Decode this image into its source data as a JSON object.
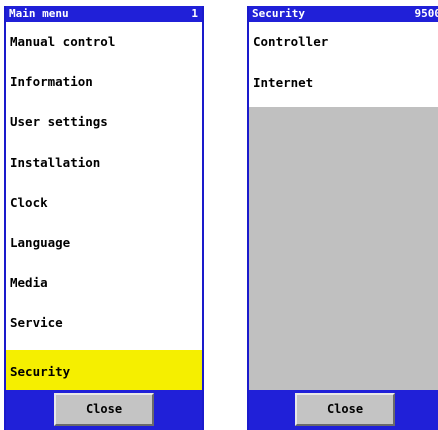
{
  "main_menu": {
    "title": "Main menu",
    "code": "1",
    "items": [
      {
        "label": "Manual control"
      },
      {
        "label": "Information"
      },
      {
        "label": "User settings"
      },
      {
        "label": "Installation"
      },
      {
        "label": "Clock"
      },
      {
        "label": "Language"
      },
      {
        "label": "Media"
      },
      {
        "label": "Service"
      },
      {
        "label": "Security",
        "selected": true
      }
    ],
    "close_label": "Close"
  },
  "security_menu": {
    "title": "Security",
    "code": "9500",
    "items": [
      {
        "label": "Controller"
      },
      {
        "label": "Internet"
      }
    ],
    "close_label": "Close"
  },
  "colors": {
    "title_bar": "#2020d8",
    "selected_item": "#f5ef00",
    "empty_area": "#c0c0c0",
    "button": "#c4c4c4"
  }
}
